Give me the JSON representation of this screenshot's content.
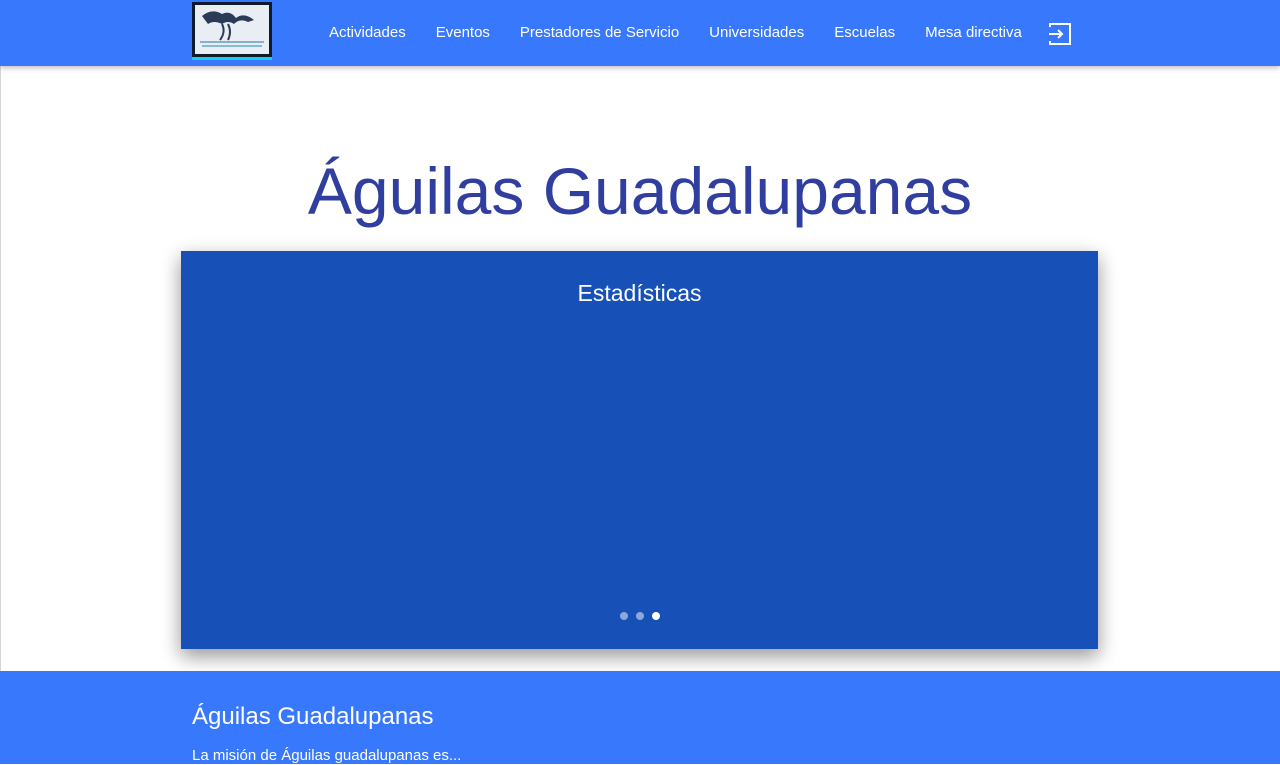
{
  "navbar": {
    "logo_text": "ÁGUILAS GUADALUPANAS",
    "links": [
      "Actividades",
      "Eventos",
      "Prestadores de Servicio",
      "Universidades",
      "Escuelas",
      "Mesa directiva"
    ],
    "logout_icon": "logout-icon"
  },
  "main": {
    "title": "Águilas Guadalupanas"
  },
  "carousel": {
    "title": "Estadísticas",
    "slide_count": 3,
    "active_index": 2,
    "background": "#1751b7"
  },
  "footer": {
    "title": "Águilas Guadalupanas",
    "text": "La misión de Águilas guadalupanas es..."
  },
  "colors": {
    "navbar": "#3878fd",
    "title": "#303f9f",
    "footer": "#3878fd"
  }
}
